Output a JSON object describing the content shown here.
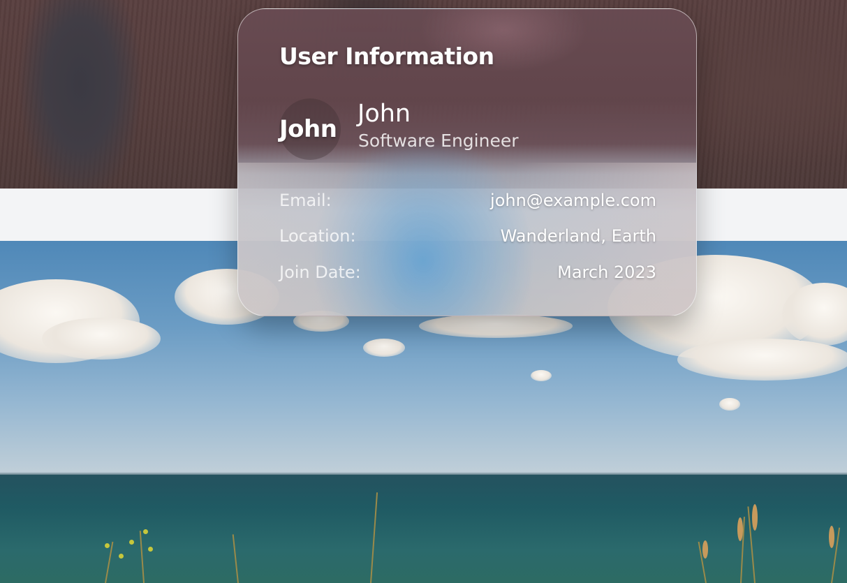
{
  "card": {
    "title": "User Information",
    "avatar_text": "John",
    "user": {
      "name": "John",
      "role": "Software Engineer"
    },
    "details": [
      {
        "label": "Email:",
        "value": "john@example.com"
      },
      {
        "label": "Location:",
        "value": "Wanderland, Earth"
      },
      {
        "label": "Join Date:",
        "value": "March 2023"
      }
    ]
  },
  "colors": {
    "card_top": "#684b52",
    "card_bottom": "#c8c4c4",
    "text": "#ffffff",
    "page_band": "#f3f4f6",
    "sky": "#6b9cc4",
    "sea": "#1f5a63"
  }
}
